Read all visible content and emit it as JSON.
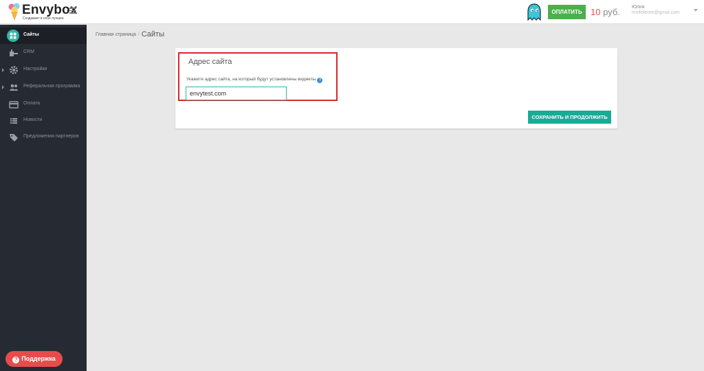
{
  "header": {
    "brand": "Envybox",
    "tagline": "Создавает в себе лучшее",
    "pay_button": "ОПЛАТИТЬ",
    "balance_amount": "10",
    "balance_unit": "руб.",
    "user_name": "Юлия",
    "user_email": "irinifoleore@gmai.com"
  },
  "sidebar": {
    "items": [
      {
        "label": "Сайты",
        "icon": "sites-icon"
      },
      {
        "label": "CRM",
        "icon": "crm-icon"
      },
      {
        "label": "Настройки",
        "icon": "gear-icon"
      },
      {
        "label": "Реферальная программа",
        "icon": "users-icon"
      },
      {
        "label": "Оплата",
        "icon": "card-icon"
      },
      {
        "label": "Новости",
        "icon": "list-icon"
      },
      {
        "label": "Предложения партнеров",
        "icon": "tag-icon"
      }
    ],
    "support_button": "Поддержка"
  },
  "breadcrumb": {
    "home": "Главная страница",
    "separator": "/",
    "current": "Сайты"
  },
  "form": {
    "title": "Адрес сайта",
    "description": "Укажите адрес сайта, на который будут установлены виджеты",
    "help_icon": "?",
    "site_value": "envytest.com",
    "save_button": "СОХРАНИТЬ И ПРОДОЛЖИТЬ"
  },
  "colors": {
    "sidebar_bg": "#262b33",
    "accent_teal": "#1aaa98",
    "pay_green": "#4bb04b",
    "support_red": "#e74c4c",
    "highlight_red": "#d9262c"
  }
}
